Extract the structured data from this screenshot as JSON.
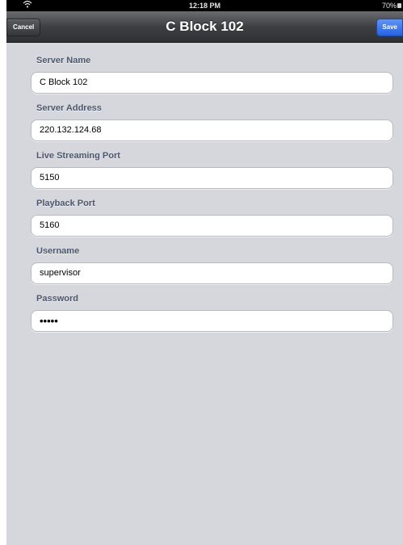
{
  "status_bar": {
    "wifi_icon": "wifi-icon",
    "time": "12:18 PM",
    "battery": "70%",
    "battery_icon": "battery-icon"
  },
  "nav": {
    "title": "C Block 102",
    "cancel_label": "Cancel",
    "save_label": "Save"
  },
  "form": {
    "fields": [
      {
        "label": "Server Name",
        "value": "C Block 102"
      },
      {
        "label": "Server Address",
        "value": "220.132.124.68"
      },
      {
        "label": "Live Streaming Port",
        "value": "5150"
      },
      {
        "label": "Playback Port",
        "value": "5160"
      },
      {
        "label": "Username",
        "value": "supervisor"
      },
      {
        "label": "Password",
        "value": "•••••"
      }
    ]
  },
  "colors": {
    "background": "#d6d7dc",
    "label": "#4c566c",
    "save_button": "#2563e6"
  }
}
